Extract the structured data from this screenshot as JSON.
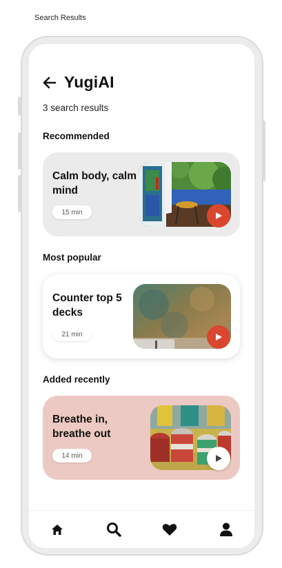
{
  "frame_caption": "Search Results",
  "header": {
    "title": "YugiAI",
    "back_icon": "arrow-left-icon"
  },
  "results_count": "3 search results",
  "sections": [
    {
      "title": "Recommended",
      "card": {
        "title": "Calm body, calm mind",
        "duration": "15 min",
        "background": "#ebebeb",
        "play_style": "red"
      }
    },
    {
      "title": "Most popular",
      "card": {
        "title": "Counter top 5 decks",
        "duration": "21 min",
        "background": "#ffffff",
        "play_style": "red"
      }
    },
    {
      "title": "Added recently",
      "card": {
        "title": "Breathe in, breathe out",
        "duration": "14 min",
        "background": "#ecc9c2",
        "play_style": "white"
      }
    }
  ],
  "nav": {
    "items": [
      {
        "icon": "home-icon"
      },
      {
        "icon": "search-icon"
      },
      {
        "icon": "heart-icon"
      },
      {
        "icon": "user-icon"
      }
    ]
  },
  "colors": {
    "accent": "#d9472e",
    "text": "#111111",
    "card_gray": "#ebebeb",
    "card_pink": "#ecc9c2"
  }
}
